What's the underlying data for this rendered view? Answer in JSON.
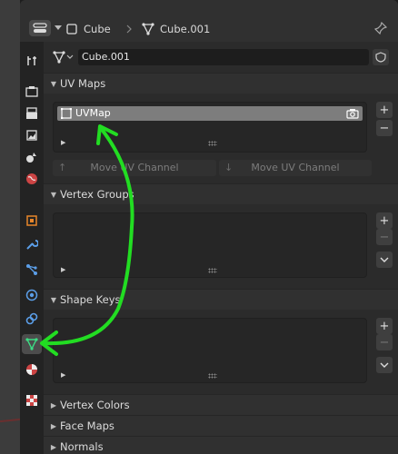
{
  "header": {
    "object_label": "Cube",
    "mesh_label": "Cube.001"
  },
  "mesh_name_field": "Cube.001",
  "panels": {
    "uv_maps": {
      "title": "UV Maps",
      "items": [
        "UVMap"
      ],
      "move_up_label": "Move UV Channel",
      "move_down_label": "Move UV Channel"
    },
    "vertex_groups": {
      "title": "Vertex Groups"
    },
    "shape_keys": {
      "title": "Shape Keys"
    },
    "vertex_colors": {
      "title": "Vertex Colors"
    },
    "face_maps": {
      "title": "Face Maps"
    },
    "normals": {
      "title": "Normals"
    }
  },
  "icons": {
    "tabs": [
      "tool-icon",
      "render-icon",
      "output-icon",
      "view-layer-icon",
      "scene-icon",
      "world-icon",
      "object-icon",
      "modifier-icon",
      "particles-icon",
      "physics-icon",
      "constraints-icon",
      "object-data-icon",
      "material-icon",
      "texture-icon"
    ]
  },
  "colors": {
    "annotation": "#22dd22",
    "selected_item": "#7d7d7d"
  }
}
